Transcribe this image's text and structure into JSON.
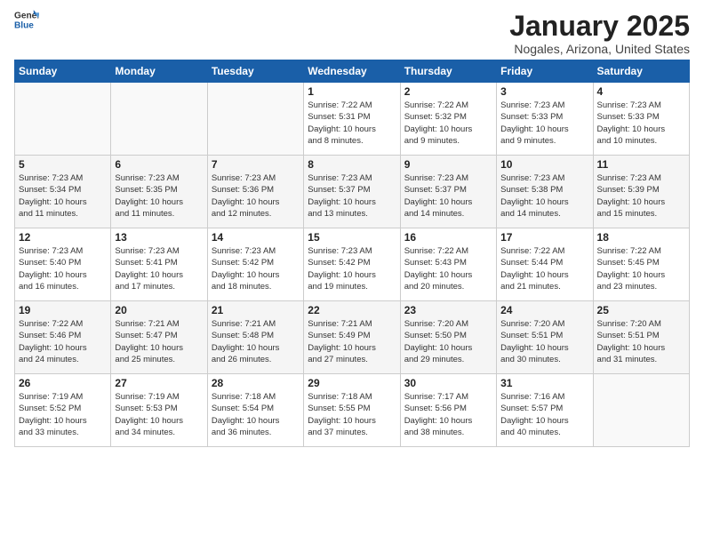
{
  "header": {
    "logo_general": "General",
    "logo_blue": "Blue",
    "month": "January 2025",
    "location": "Nogales, Arizona, United States"
  },
  "weekdays": [
    "Sunday",
    "Monday",
    "Tuesday",
    "Wednesday",
    "Thursday",
    "Friday",
    "Saturday"
  ],
  "weeks": [
    [
      {
        "day": "",
        "info": ""
      },
      {
        "day": "",
        "info": ""
      },
      {
        "day": "",
        "info": ""
      },
      {
        "day": "1",
        "info": "Sunrise: 7:22 AM\nSunset: 5:31 PM\nDaylight: 10 hours\nand 8 minutes."
      },
      {
        "day": "2",
        "info": "Sunrise: 7:22 AM\nSunset: 5:32 PM\nDaylight: 10 hours\nand 9 minutes."
      },
      {
        "day": "3",
        "info": "Sunrise: 7:23 AM\nSunset: 5:33 PM\nDaylight: 10 hours\nand 9 minutes."
      },
      {
        "day": "4",
        "info": "Sunrise: 7:23 AM\nSunset: 5:33 PM\nDaylight: 10 hours\nand 10 minutes."
      }
    ],
    [
      {
        "day": "5",
        "info": "Sunrise: 7:23 AM\nSunset: 5:34 PM\nDaylight: 10 hours\nand 11 minutes."
      },
      {
        "day": "6",
        "info": "Sunrise: 7:23 AM\nSunset: 5:35 PM\nDaylight: 10 hours\nand 11 minutes."
      },
      {
        "day": "7",
        "info": "Sunrise: 7:23 AM\nSunset: 5:36 PM\nDaylight: 10 hours\nand 12 minutes."
      },
      {
        "day": "8",
        "info": "Sunrise: 7:23 AM\nSunset: 5:37 PM\nDaylight: 10 hours\nand 13 minutes."
      },
      {
        "day": "9",
        "info": "Sunrise: 7:23 AM\nSunset: 5:37 PM\nDaylight: 10 hours\nand 14 minutes."
      },
      {
        "day": "10",
        "info": "Sunrise: 7:23 AM\nSunset: 5:38 PM\nDaylight: 10 hours\nand 14 minutes."
      },
      {
        "day": "11",
        "info": "Sunrise: 7:23 AM\nSunset: 5:39 PM\nDaylight: 10 hours\nand 15 minutes."
      }
    ],
    [
      {
        "day": "12",
        "info": "Sunrise: 7:23 AM\nSunset: 5:40 PM\nDaylight: 10 hours\nand 16 minutes."
      },
      {
        "day": "13",
        "info": "Sunrise: 7:23 AM\nSunset: 5:41 PM\nDaylight: 10 hours\nand 17 minutes."
      },
      {
        "day": "14",
        "info": "Sunrise: 7:23 AM\nSunset: 5:42 PM\nDaylight: 10 hours\nand 18 minutes."
      },
      {
        "day": "15",
        "info": "Sunrise: 7:23 AM\nSunset: 5:42 PM\nDaylight: 10 hours\nand 19 minutes."
      },
      {
        "day": "16",
        "info": "Sunrise: 7:22 AM\nSunset: 5:43 PM\nDaylight: 10 hours\nand 20 minutes."
      },
      {
        "day": "17",
        "info": "Sunrise: 7:22 AM\nSunset: 5:44 PM\nDaylight: 10 hours\nand 21 minutes."
      },
      {
        "day": "18",
        "info": "Sunrise: 7:22 AM\nSunset: 5:45 PM\nDaylight: 10 hours\nand 23 minutes."
      }
    ],
    [
      {
        "day": "19",
        "info": "Sunrise: 7:22 AM\nSunset: 5:46 PM\nDaylight: 10 hours\nand 24 minutes."
      },
      {
        "day": "20",
        "info": "Sunrise: 7:21 AM\nSunset: 5:47 PM\nDaylight: 10 hours\nand 25 minutes."
      },
      {
        "day": "21",
        "info": "Sunrise: 7:21 AM\nSunset: 5:48 PM\nDaylight: 10 hours\nand 26 minutes."
      },
      {
        "day": "22",
        "info": "Sunrise: 7:21 AM\nSunset: 5:49 PM\nDaylight: 10 hours\nand 27 minutes."
      },
      {
        "day": "23",
        "info": "Sunrise: 7:20 AM\nSunset: 5:50 PM\nDaylight: 10 hours\nand 29 minutes."
      },
      {
        "day": "24",
        "info": "Sunrise: 7:20 AM\nSunset: 5:51 PM\nDaylight: 10 hours\nand 30 minutes."
      },
      {
        "day": "25",
        "info": "Sunrise: 7:20 AM\nSunset: 5:51 PM\nDaylight: 10 hours\nand 31 minutes."
      }
    ],
    [
      {
        "day": "26",
        "info": "Sunrise: 7:19 AM\nSunset: 5:52 PM\nDaylight: 10 hours\nand 33 minutes."
      },
      {
        "day": "27",
        "info": "Sunrise: 7:19 AM\nSunset: 5:53 PM\nDaylight: 10 hours\nand 34 minutes."
      },
      {
        "day": "28",
        "info": "Sunrise: 7:18 AM\nSunset: 5:54 PM\nDaylight: 10 hours\nand 36 minutes."
      },
      {
        "day": "29",
        "info": "Sunrise: 7:18 AM\nSunset: 5:55 PM\nDaylight: 10 hours\nand 37 minutes."
      },
      {
        "day": "30",
        "info": "Sunrise: 7:17 AM\nSunset: 5:56 PM\nDaylight: 10 hours\nand 38 minutes."
      },
      {
        "day": "31",
        "info": "Sunrise: 7:16 AM\nSunset: 5:57 PM\nDaylight: 10 hours\nand 40 minutes."
      },
      {
        "day": "",
        "info": ""
      }
    ]
  ]
}
